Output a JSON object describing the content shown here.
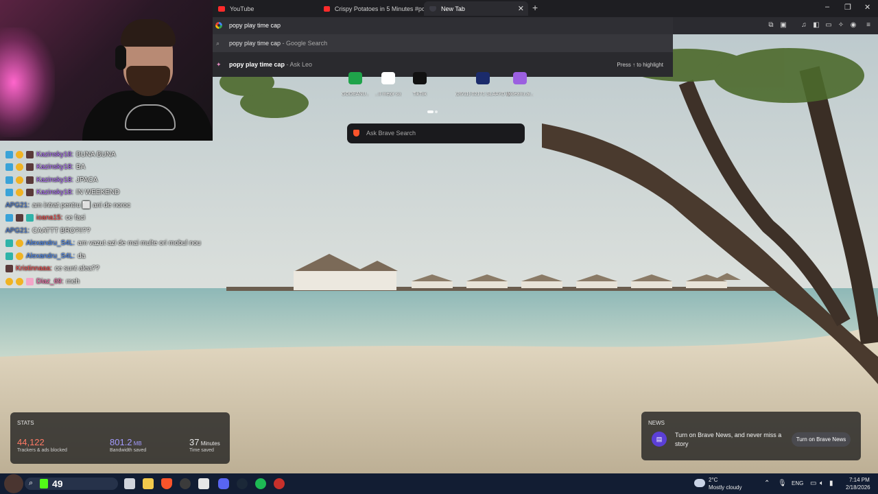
{
  "tabs": [
    {
      "title": "YouTube",
      "icon": "youtube-icon"
    },
    {
      "title": "Crispy Potatoes in 5 Minutes #potato",
      "icon": "youtube-icon"
    },
    {
      "title": "New Tab",
      "icon": "brave-shield-icon",
      "close": "✕"
    }
  ],
  "new_tab_symbol": "+",
  "window_controls": {
    "minimize": "–",
    "maximize": "❐",
    "close": "✕"
  },
  "omnibox": {
    "query": "popy play time cap"
  },
  "suggestions": [
    {
      "icon": "search-icon",
      "text": "popy play time cap",
      "source": " - Google Search"
    },
    {
      "icon": "leo-icon",
      "text": "popy play time cap",
      "source": " - Ask Leo",
      "hint": "Press ↑ to highlight"
    }
  ],
  "top_sites": [
    {
      "label": "GODEANU...",
      "color": "#1fa34a"
    },
    {
      "label": "...II mejor so...",
      "color": "#ffffff"
    },
    {
      "label": "TikTok",
      "color": "#111111"
    },
    {
      "label": "(26/11) 02171 SLAAYD Wi...",
      "color": "#1b2b6b"
    },
    {
      "label": "godeanu.al...",
      "color": "#9b5fe0"
    }
  ],
  "brave_search": {
    "placeholder": "Ask Brave Search"
  },
  "chat": [
    {
      "user": "Kazinsky18:",
      "text": "BUNA BUNA",
      "color_class": "u-purple",
      "badges": [
        "b-blue",
        "b-gold",
        "b-dark"
      ]
    },
    {
      "user": "Kazinsky18:",
      "text": "BA",
      "color_class": "u-purple",
      "badges": [
        "b-blue",
        "b-gold",
        "b-dark"
      ]
    },
    {
      "user": "Kazinsky18:",
      "text": "JPACA",
      "color_class": "u-purple",
      "badges": [
        "b-blue",
        "b-gold",
        "b-dark"
      ]
    },
    {
      "user": "Kazinsky18:",
      "text": "IN WEEKEND",
      "color_class": "u-purple",
      "badges": [
        "b-blue",
        "b-gold",
        "b-dark"
      ]
    },
    {
      "user": "APG21:",
      "text": "am intrat pentru ⬜ ani de noroc",
      "color_class": "u-steel",
      "badges": []
    },
    {
      "user": "ioana15:",
      "text": "ce faci",
      "color_class": "u-red",
      "badges": [
        "b-blue",
        "b-dark",
        "b-teal"
      ]
    },
    {
      "user": "APG21:",
      "text": "CAATTT BRO?!!??",
      "color_class": "u-steel",
      "badges": []
    },
    {
      "user": "Alexandru_S4L:",
      "text": "am vazut azi de mai multe ori mobul nou",
      "color_class": "u-blue",
      "badges": [
        "b-teal",
        "b-gold"
      ]
    },
    {
      "user": "Alexandru_S4L:",
      "text": "da",
      "color_class": "u-blue",
      "badges": [
        "b-teal",
        "b-gold"
      ]
    },
    {
      "user": "Kristinnaaa:",
      "text": "ce sunt alea??",
      "color_class": "u-red",
      "badges": [
        "b-dark"
      ]
    },
    {
      "user": "Diaz_69:",
      "text": "meh",
      "color_class": "u-pink",
      "badges": [
        "b-gold",
        "b-gold",
        "b-pink"
      ]
    }
  ],
  "stats": {
    "heading": "STATS",
    "items": [
      {
        "number": "44,122",
        "unit": "",
        "label": "Trackers & ads blocked",
        "color": "#ff7a66"
      },
      {
        "number": "801.2",
        "unit": " MB",
        "label": "Bandwidth saved",
        "color": "#a49cff"
      },
      {
        "number": "37",
        "unit": " Minutes",
        "label": "Time saved",
        "color": "#ffffff"
      }
    ]
  },
  "news": {
    "heading": "NEWS",
    "text": "Turn on Brave News, and never miss a story",
    "button": "Turn on Brave News"
  },
  "taskbar": {
    "counter": "49",
    "weather_temp": "2°C",
    "weather_desc": "Mostly cloudy",
    "language": "ENG",
    "time": "7:14 PM",
    "date": "2/18/2026"
  }
}
